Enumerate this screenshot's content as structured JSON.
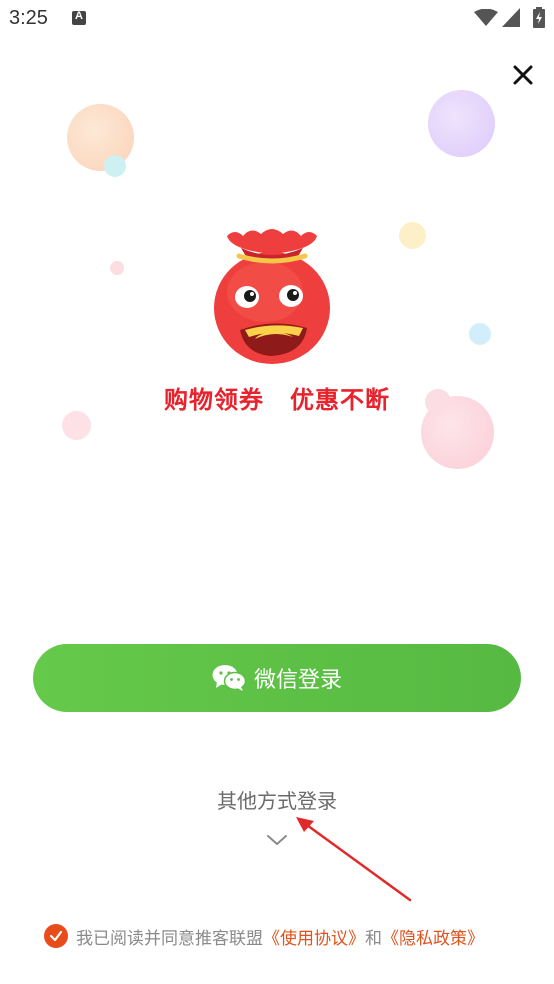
{
  "status_bar": {
    "time": "3:25",
    "notification_icon": "A"
  },
  "close": {
    "icon": "close-icon"
  },
  "slogan": {
    "left": "购物领券",
    "right": "优惠不断"
  },
  "wechat_login": {
    "icon": "wechat-icon",
    "label": "微信登录",
    "color": "#5cbf45"
  },
  "other_login": {
    "label": "其他方式登录",
    "icon": "chevron-down-icon"
  },
  "agreement": {
    "checked": true,
    "text": "我已阅读并同意推客联盟",
    "terms_link": "《使用协议》",
    "and": "和",
    "privacy_link": "《隐私政策》",
    "accent": "#e84c1b"
  }
}
